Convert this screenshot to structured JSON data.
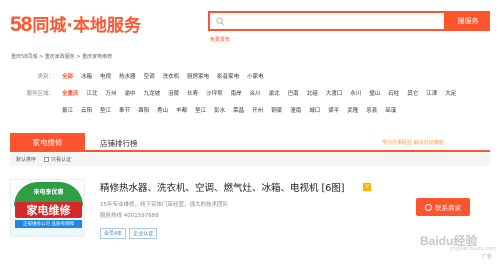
{
  "header": {
    "logo_number": "58",
    "logo_name": "同城·本地服务",
    "search_placeholder": "",
    "search_button": "搜服务",
    "publish_link": "免费发布"
  },
  "breadcrumb": "重庆58同城 > 重庆家政服务 > 重庆家电维修",
  "filters": {
    "category": {
      "label": "类别：",
      "options": [
        "全部",
        "冰箱",
        "电视",
        "热水器",
        "空调",
        "洗衣机",
        "厨房家电",
        "影音家电",
        "小家电"
      ],
      "selected_index": 0
    },
    "area": {
      "label": "服务区域：",
      "row1": [
        "全重庆",
        "江北",
        "万州",
        "渝中",
        "九龙坡",
        "涪陵",
        "长寿",
        "沙坪坝",
        "南岸",
        "合川",
        "渝北",
        "巴南",
        "北碚",
        "大渡口",
        "永川",
        "璧山",
        "石柱",
        "其它",
        "江津",
        "大足"
      ],
      "row2": [
        "綦江",
        "云阳",
        "垫江",
        "奉节",
        "酉阳",
        "秀山",
        "丰都",
        "垫江",
        "彭水",
        "荣昌",
        "开州",
        "铜梁",
        "潼南",
        "城口",
        "梁平",
        "武隆",
        "忠县",
        "巫溪"
      ],
      "selected_index": 0
    }
  },
  "tabs": {
    "active": "家电维修",
    "second": "店铺排行榜",
    "promo": "学习办事经验 解决办证难题"
  },
  "sortbar": {
    "default_sort": "默认排序",
    "verified_label": "只看认证"
  },
  "listing": {
    "thumb": {
      "arc_text": "来电享优惠",
      "big_text": "家电维修",
      "sub_text": "正规维修公司 品质有保障"
    },
    "title": "精修热水器、洗衣机、空调、燃气灶、冰箱、电视机 [6图]",
    "badge": "V",
    "description": "15年专业维修，线下实体门店经营，强大的技术团队",
    "phone_label": "服务热线",
    "phone": "4001597688",
    "tags": [
      "会员4年",
      "企业认证"
    ],
    "contact_button": "联系商家"
  },
  "watermark": "Baidu经验",
  "watermark_sub": "jingyan.baidu.com",
  "ad_label": "广告"
}
